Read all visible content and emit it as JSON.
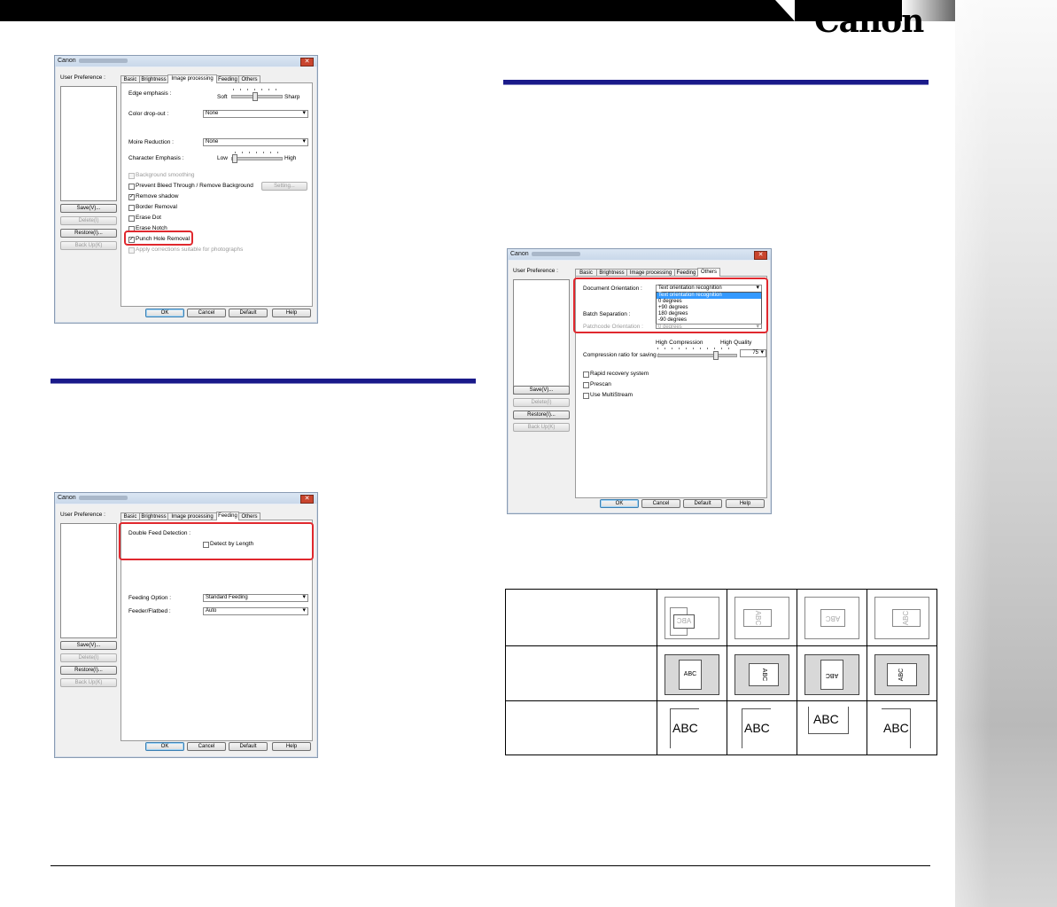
{
  "brand": {
    "logo": "Canon"
  },
  "dialog_common": {
    "title": "Canon",
    "close_icon": "close-icon",
    "user_preference_label": "User Preference :",
    "buttons": {
      "save": "Save(V)...",
      "delete": "Delete(I)",
      "restore": "Restore(I)...",
      "backup": "Back Up(K)"
    },
    "footer": {
      "ok": "OK",
      "cancel": "Cancel",
      "default": "Default",
      "help": "Help"
    },
    "tabs": [
      "Basic",
      "Brightness",
      "Image processing",
      "Feeding",
      "Others"
    ]
  },
  "dialog_image_processing": {
    "active_tab": "Image processing",
    "edge_emphasis": {
      "label": "Edge emphasis :",
      "min": "Soft",
      "max": "Sharp"
    },
    "color_drop_out": {
      "label": "Color drop-out :",
      "value": "None"
    },
    "moire_reduction": {
      "label": "Moire Reduction :",
      "value": "None"
    },
    "character_emphasis": {
      "label": "Character Emphasis :",
      "min": "Low",
      "max": "High"
    },
    "checkboxes": [
      {
        "label": "Background smoothing",
        "checked": false,
        "enabled": false
      },
      {
        "label": "Prevent Bleed Through / Remove Background",
        "checked": false,
        "enabled": true
      },
      {
        "label": "Remove shadow",
        "checked": true,
        "enabled": true
      },
      {
        "label": "Border Removal",
        "checked": false,
        "enabled": true
      },
      {
        "label": "Erase Dot",
        "checked": false,
        "enabled": true
      },
      {
        "label": "Erase Notch",
        "checked": false,
        "enabled": true
      },
      {
        "label": "Punch Hole Removal",
        "checked": true,
        "enabled": true
      },
      {
        "label": "Apply corrections suitable for photographs",
        "checked": false,
        "enabled": false
      }
    ],
    "setting_button": "Setting..."
  },
  "dialog_feeding": {
    "active_tab": "Feeding",
    "double_feed_detection": {
      "label": "Double Feed Detection :",
      "detect_by_length": "Detect by Length"
    },
    "feeding_option": {
      "label": "Feeding Option :",
      "value": "Standard Feeding"
    },
    "feeder_flatbed": {
      "label": "Feeder/Flatbed :",
      "value": "Auto"
    }
  },
  "dialog_others": {
    "active_tab": "Others",
    "document_orientation": {
      "label": "Document Orientation :",
      "value": "Text orientation recognition",
      "options": [
        "Text orientation recognition",
        "0 degrees",
        "+90 degrees",
        "180 degrees",
        "-90 degrees"
      ]
    },
    "batch_separation": {
      "label": "Batch Separation :"
    },
    "patchcode_orientation": {
      "label": "Patchcode Orientation :",
      "value": "0 degrees"
    },
    "compression": {
      "label": "Compression ratio for saving :",
      "min": "High Compression",
      "max": "High Quality",
      "value": "75"
    },
    "checkboxes": [
      {
        "label": "Rapid recovery system",
        "checked": false
      },
      {
        "label": "Prescan",
        "checked": false
      },
      {
        "label": "Use MultiStream",
        "checked": false
      }
    ]
  },
  "orientation_table": {
    "sample_text": "ABC"
  }
}
